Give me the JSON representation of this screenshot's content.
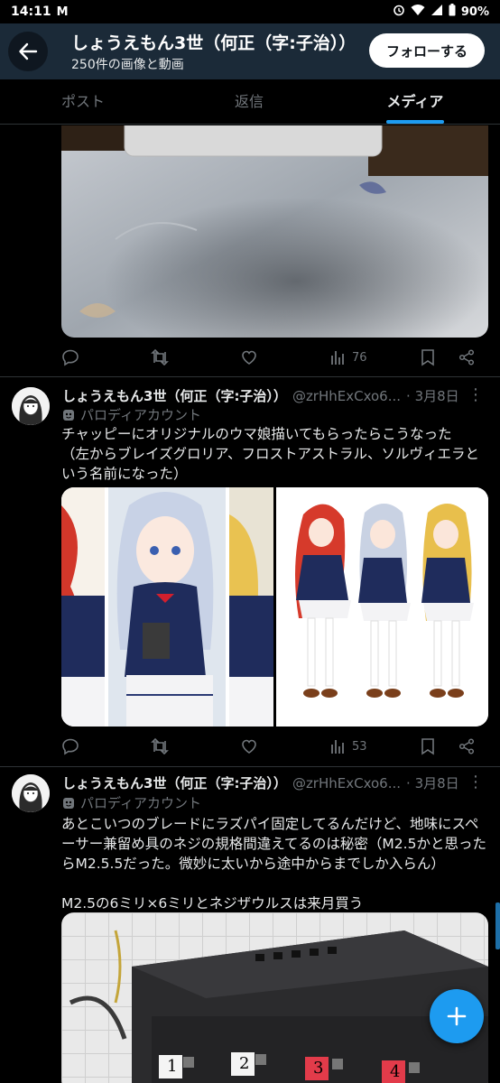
{
  "status_bar": {
    "time": "14:11",
    "gmail_glyph": "M",
    "battery": "90%"
  },
  "header": {
    "title": "しょうえもん3世（何正（字:子治））",
    "subtitle": "250件の画像と動画",
    "follow_label": "フォローする"
  },
  "tabs": [
    {
      "label": "ポスト",
      "active": false
    },
    {
      "label": "返信",
      "active": false
    },
    {
      "label": "メディア",
      "active": true
    }
  ],
  "tweets": [
    {
      "views": "76"
    },
    {
      "name": "しょうえもん3世（何正（字:子治））",
      "handle": "@zrHhExCxo6...",
      "date": "· 3月8日",
      "badge": "パロディアカウント",
      "text": "チャッピーにオリジナルのウマ娘描いてもらったらこうなった\n（左からブレイズグロリア、フロストアストラル、ソルヴィエラと\nいう名前になった）",
      "views": "53"
    },
    {
      "name": "しょうえもん3世（何正（字:子治））",
      "handle": "@zrHhExCxo6...",
      "date": "· 3月8日",
      "badge": "パロディアカウント",
      "text": "あとこいつのブレードにラズパイ固定してるんだけど、地味にスペ\nーサー兼留め具のネジの規格間違えてるのは秘密（M2.5かと思った\nらM2.5.5だった。微妙に太いから途中からまでしか入らん）\n\nM2.5の6ミリ×6ミリとネジザウルスは来月買う",
      "photo_labels": [
        "1",
        "2",
        "3",
        "4"
      ]
    }
  ],
  "more_glyph": "⋮",
  "colors": {
    "header_bg": "#1b2a38",
    "accent": "#1d9bf0",
    "muted": "#71767b",
    "text": "#e7e9ea"
  }
}
